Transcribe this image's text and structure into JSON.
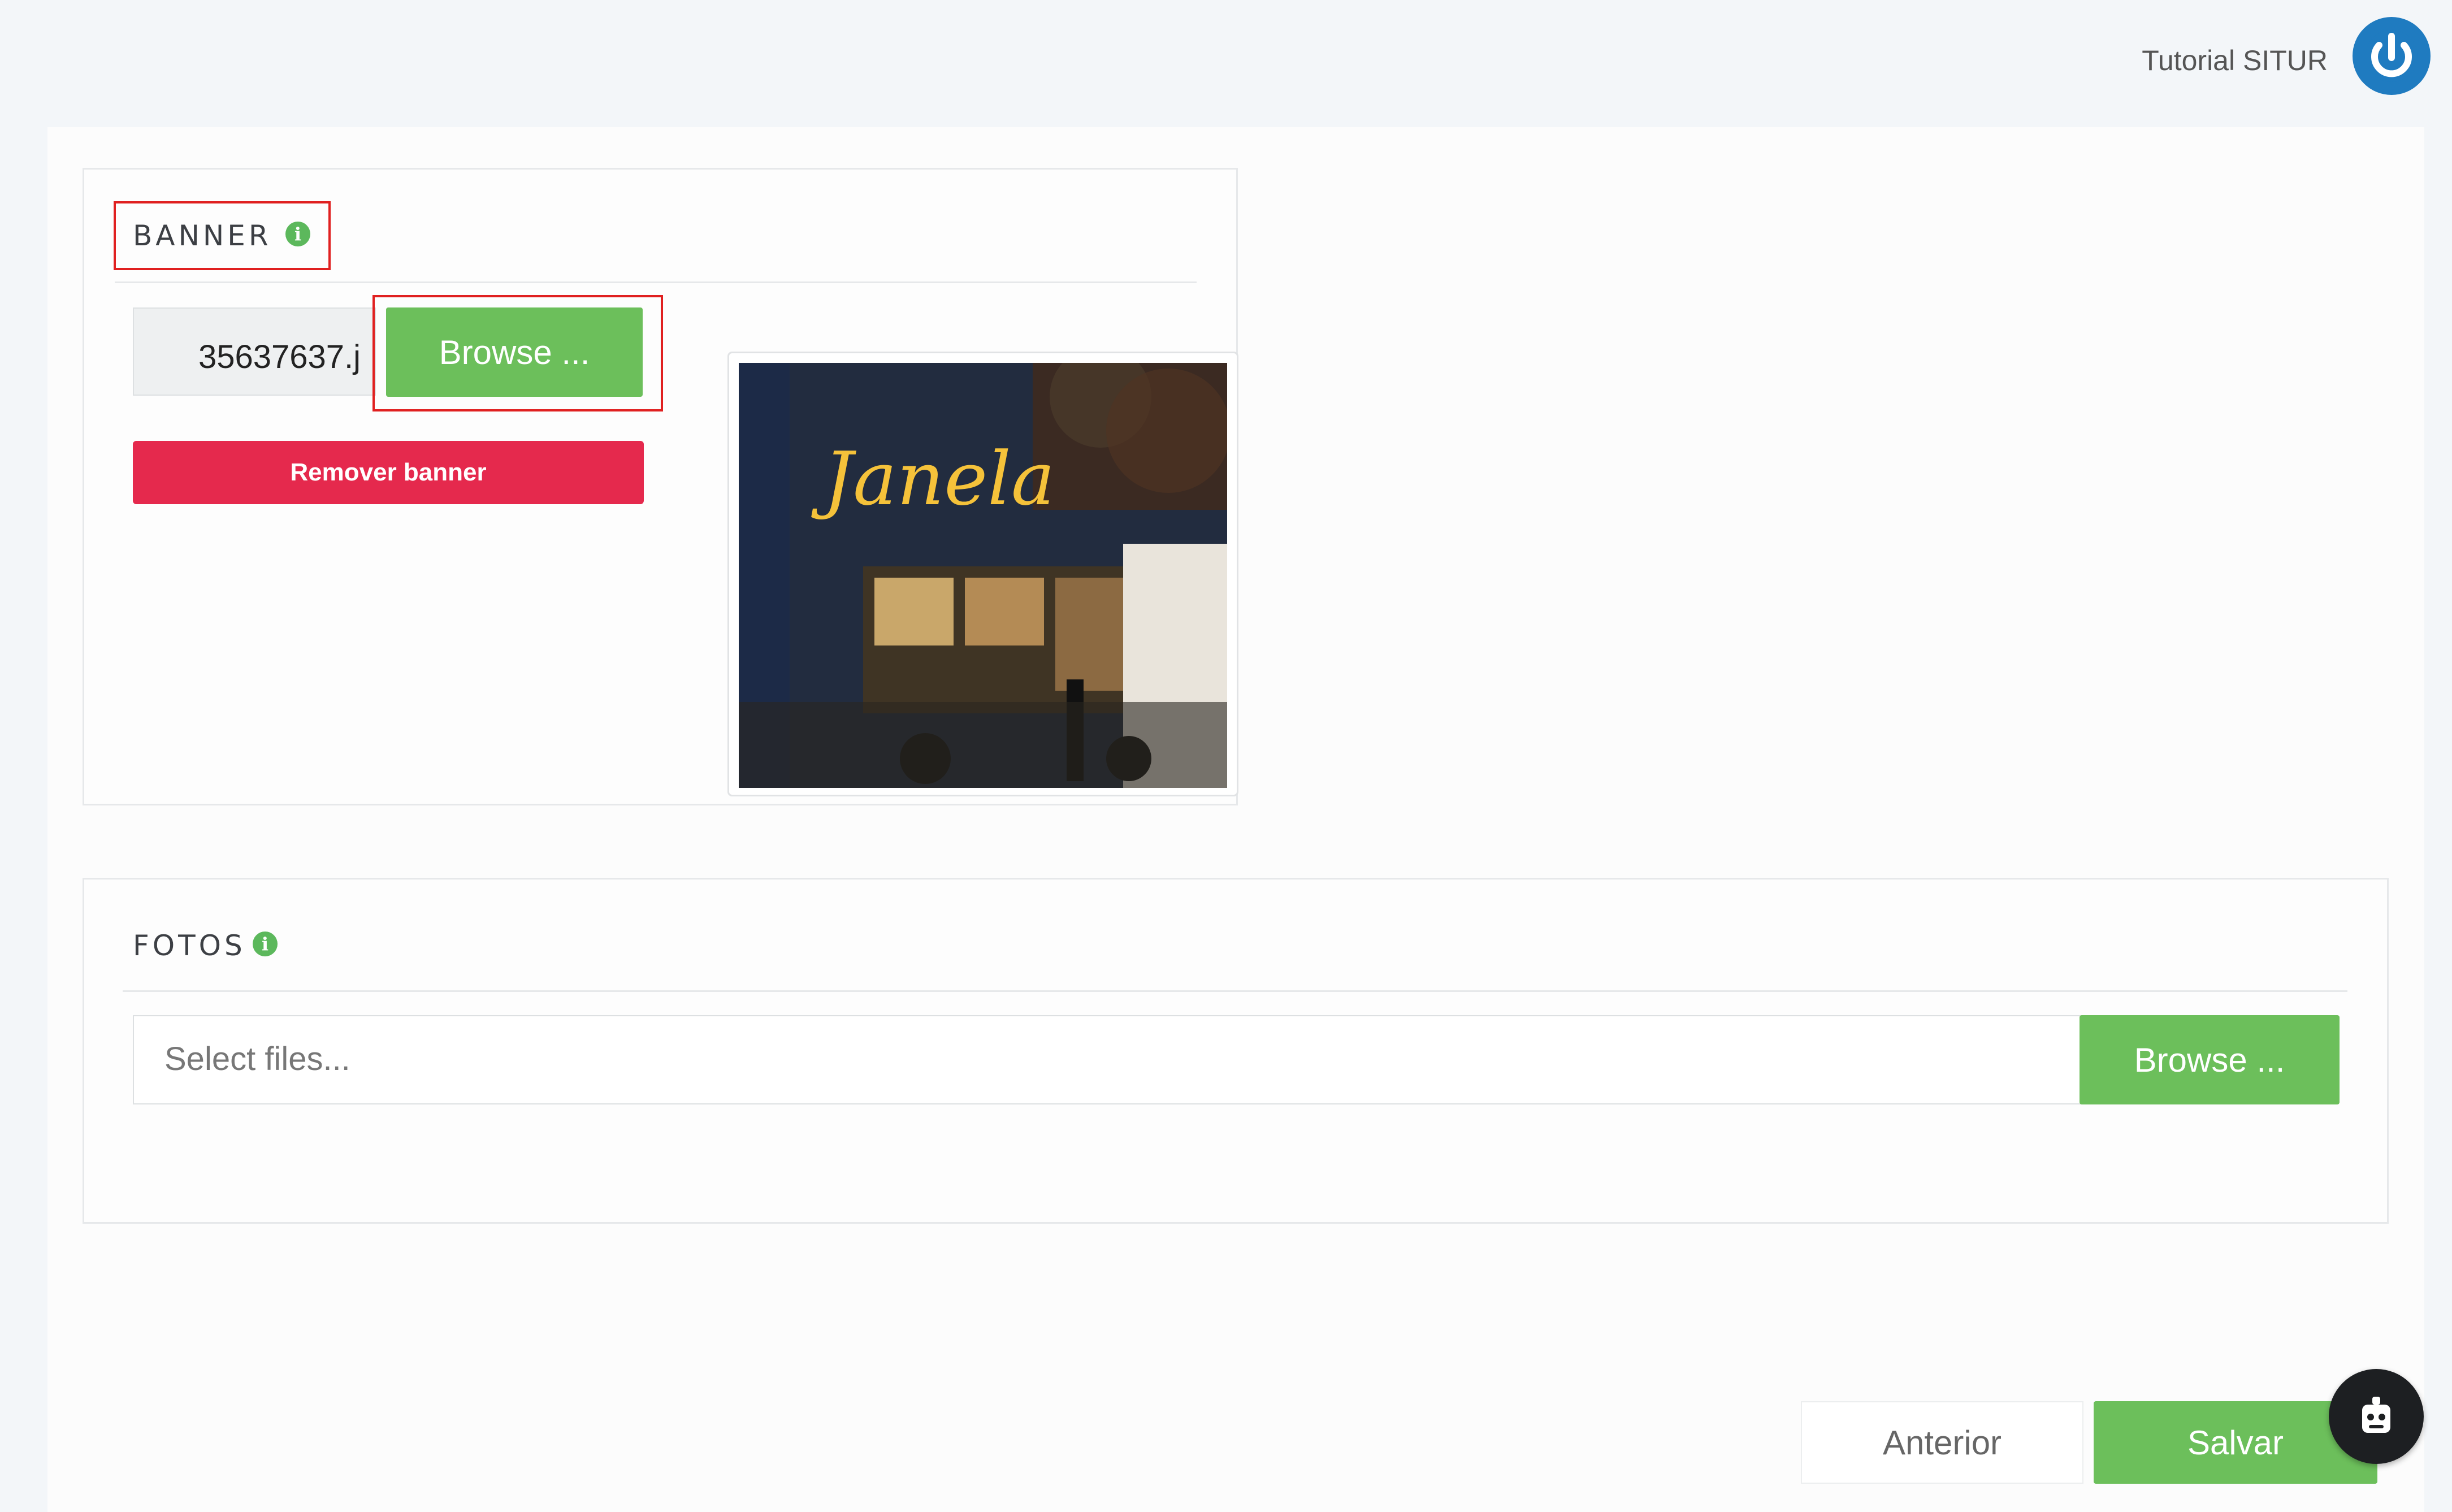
{
  "header": {
    "user_name": "Tutorial SITUR",
    "power_icon": "power-icon"
  },
  "banner": {
    "title": "BANNER",
    "info_icon": "info-icon",
    "file_name": "35637637.j",
    "browse_label": "Browse ...",
    "remove_label": "Remover banner",
    "preview_sign": "Janela"
  },
  "fotos": {
    "title": "FOTOS",
    "info_icon": "info-icon",
    "placeholder": "Select files...",
    "browse_label": "Browse ..."
  },
  "footer": {
    "previous_label": "Anterior",
    "save_label": "Salvar",
    "help_icon": "robot-icon"
  },
  "colors": {
    "accent_green": "#6cbf5b",
    "danger_red": "#e5294d",
    "power_blue": "#1f7bc0",
    "highlight_red": "#e02020"
  }
}
